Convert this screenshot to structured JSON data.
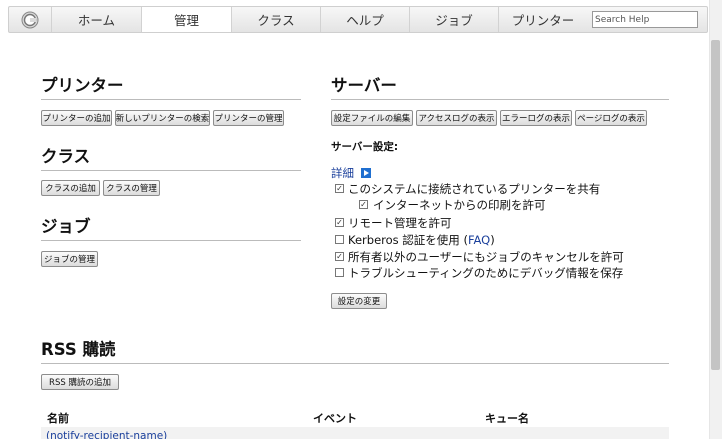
{
  "nav": {
    "tabs": [
      "ホーム",
      "管理",
      "クラス",
      "ヘルプ",
      "ジョブ",
      "プリンター"
    ],
    "active_tab": "管理",
    "search_placeholder": "Search Help"
  },
  "printers": {
    "title": "プリンター",
    "buttons": [
      "プリンターの追加",
      "新しいプリンターの検索",
      "プリンターの管理"
    ]
  },
  "classes": {
    "title": "クラス",
    "buttons": [
      "クラスの追加",
      "クラスの管理"
    ]
  },
  "jobs": {
    "title": "ジョブ",
    "buttons": [
      "ジョブの管理"
    ]
  },
  "server": {
    "title": "サーバー",
    "buttons": [
      "設定ファイルの編集",
      "アクセスログの表示",
      "エラーログの表示",
      "ページログの表示"
    ],
    "settings_label": "サーバー設定:",
    "advanced_link": "詳細",
    "options": [
      {
        "label": "このシステムに接続されているプリンターを共有",
        "checked": true
      },
      {
        "label": "インターネットからの印刷を許可",
        "checked": true
      },
      {
        "label": "リモート管理を許可",
        "checked": true
      },
      {
        "label": "Kerberos 認証を使用 (",
        "link": "FAQ",
        "suffix": ")",
        "checked": false
      },
      {
        "label": "所有者以外のユーザーにもジョブのキャンセルを許可",
        "checked": true
      },
      {
        "label": "トラブルシューティングのためにデバッグ情報を保存",
        "checked": false
      }
    ],
    "apply_button": "設定の変更"
  },
  "rss": {
    "title": "RSS 購読",
    "add_button": "RSS 購読の追加",
    "columns": [
      "名前",
      "イベント",
      "キュー名"
    ],
    "row_name": "(notify-recipient-name)"
  },
  "colors": {
    "accent_link": "#1a3f9b",
    "nav_bg": "#e9e9e9",
    "expand_icon": "#1f6fd0"
  }
}
